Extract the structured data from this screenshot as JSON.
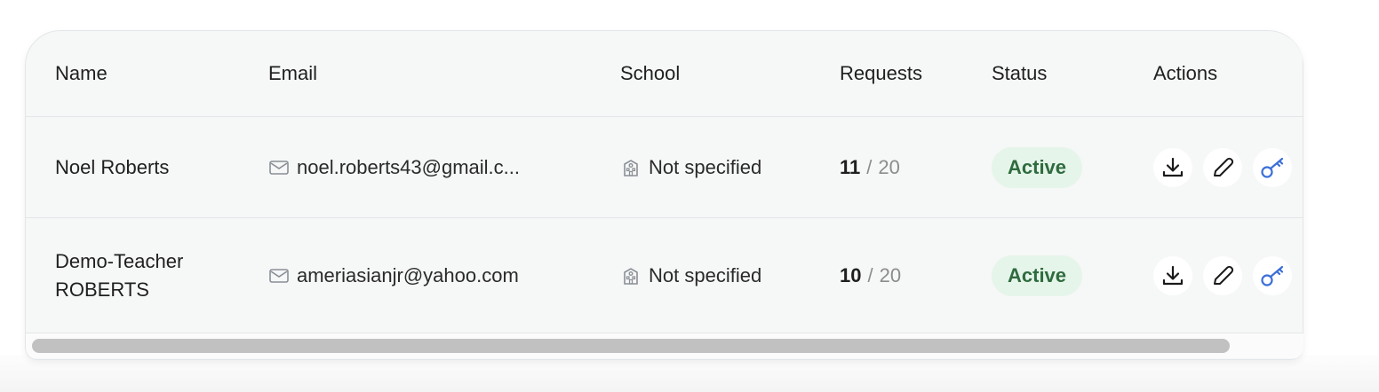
{
  "table": {
    "headers": {
      "name": "Name",
      "email": "Email",
      "school": "School",
      "requests": "Requests",
      "status": "Status",
      "actions": "Actions"
    },
    "rows": [
      {
        "name_line1": "Noel Roberts",
        "name_line2": "",
        "email": "noel.roberts43@gmail.c...",
        "school": "Not specified",
        "requests_used": "11",
        "requests_separator": "/",
        "requests_total": "20",
        "status": "Active"
      },
      {
        "name_line1": "Demo-Teacher",
        "name_line2": "ROBERTS",
        "email": "ameriasianjr@yahoo.com",
        "school": "Not specified",
        "requests_used": "10",
        "requests_separator": "/",
        "requests_total": "20",
        "status": "Active"
      }
    ]
  },
  "icons": {
    "email": "mail-icon",
    "school": "school-building-icon",
    "download": "download-icon",
    "edit": "pencil-icon",
    "key": "key-icon"
  },
  "colors": {
    "status_badge_bg": "#e5f5ea",
    "status_badge_text": "#2f6b3e",
    "key_icon": "#3b6fd8"
  }
}
